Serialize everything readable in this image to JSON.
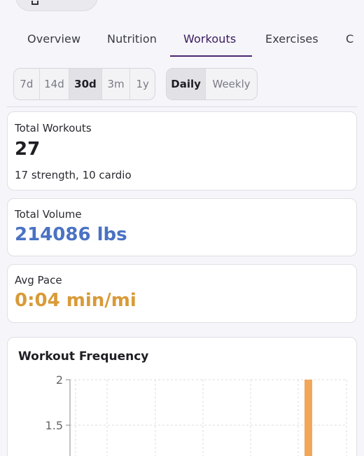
{
  "tabs": [
    {
      "label": "Overview",
      "active": false
    },
    {
      "label": "Nutrition",
      "active": false
    },
    {
      "label": "Workouts",
      "active": true
    },
    {
      "label": "Exercises",
      "active": false
    },
    {
      "label": "C",
      "active": false
    }
  ],
  "range_options": [
    {
      "label": "7d",
      "active": false
    },
    {
      "label": "14d",
      "active": false
    },
    {
      "label": "30d",
      "active": true
    },
    {
      "label": "3m",
      "active": false
    },
    {
      "label": "1y",
      "active": false
    }
  ],
  "granularity_options": [
    {
      "label": "Daily",
      "active": true
    },
    {
      "label": "Weekly",
      "active": false
    }
  ],
  "stats": {
    "total_workouts": {
      "label": "Total Workouts",
      "value": "27",
      "sub": "17 strength, 10 cardio"
    },
    "total_volume": {
      "label": "Total Volume",
      "value": "214086 lbs",
      "color": "#4a72c4"
    },
    "avg_pace": {
      "label": "Avg Pace",
      "value": "0:04 min/mi",
      "color": "#d99a38"
    }
  },
  "chart_data": {
    "type": "bar",
    "title": "Workout Frequency",
    "y_ticks": [
      "2",
      "1.5"
    ],
    "ylim_visible": [
      1.5,
      2
    ],
    "bar_value": 2,
    "bar_color": "#f2a65a",
    "grid": true
  }
}
